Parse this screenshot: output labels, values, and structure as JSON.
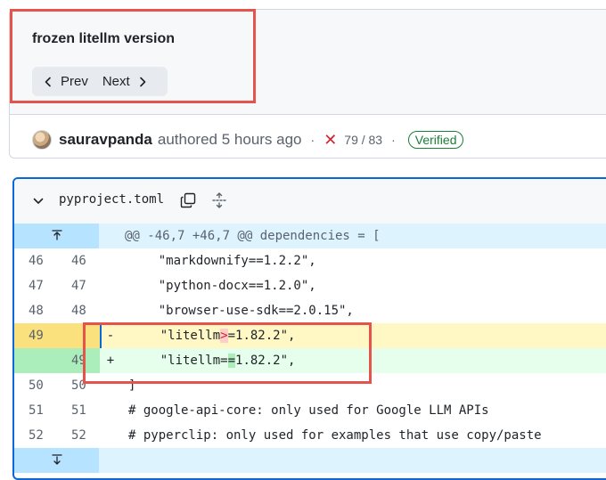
{
  "commit": {
    "title": "frozen litellm version",
    "prev_label": "Prev",
    "next_label": "Next",
    "author": "sauravpanda",
    "authored_text": "authored 5 hours ago",
    "checks_icon": "x-icon",
    "checks_status": "79 / 83",
    "verified_label": "Verified"
  },
  "file": {
    "name": "pyproject.toml",
    "hunk_header": "@@ -46,7 +46,7 @@ dependencies = [",
    "lines": [
      {
        "old": "46",
        "new": "46",
        "sign": "",
        "pre": "    \"markdownify==1.2.2\",",
        "mark": "",
        "post": ""
      },
      {
        "old": "47",
        "new": "47",
        "sign": "",
        "pre": "    \"python-docx==1.2.0\",",
        "mark": "",
        "post": ""
      },
      {
        "old": "48",
        "new": "48",
        "sign": "",
        "pre": "    \"browser-use-sdk==2.0.15\",",
        "mark": "",
        "post": ""
      },
      {
        "old": "49",
        "new": "",
        "sign": "-",
        "pre": "    \"litellm",
        "mark": ">",
        "post": "=1.82.2\","
      },
      {
        "old": "",
        "new": "49",
        "sign": "+",
        "pre": "    \"litellm=",
        "mark": "=",
        "post": "1.82.2\","
      },
      {
        "old": "50",
        "new": "50",
        "sign": "",
        "pre": "]",
        "mark": "",
        "post": ""
      },
      {
        "old": "51",
        "new": "51",
        "sign": "",
        "pre": "# google-api-core: only used for Google LLM APIs",
        "mark": "",
        "post": ""
      },
      {
        "old": "52",
        "new": "52",
        "sign": "",
        "pre": "# pyperclip: only used for examples that use copy/paste",
        "mark": "",
        "post": ""
      }
    ]
  },
  "colors": {
    "highlight_box": "#e5534b",
    "accent": "#0969da",
    "deletion_bg": "#fff8c5",
    "addition_bg": "#e6ffec"
  }
}
